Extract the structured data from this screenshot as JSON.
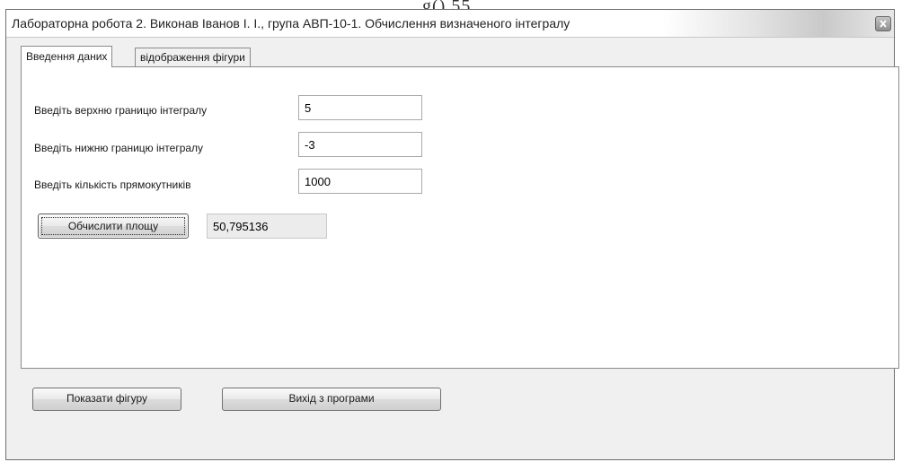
{
  "window": {
    "title": "Лабораторна робота 2. Виконав Іванов І. І., група АВП-10-1. Обчислення визначеного інтегралу"
  },
  "tabs": [
    {
      "label": "Введення даних",
      "active": true
    },
    {
      "label": "відображення фігури",
      "active": false
    }
  ],
  "form": {
    "upper_label": "Введіть верхню границю інтегралу",
    "upper_value": "5",
    "lower_label": "Введіть нижню границю інтегралу",
    "lower_value": "-3",
    "count_label": "Введіть кількість прямокутників",
    "count_value": "1000",
    "calc_button": "Обчислити площу",
    "result_value": "50,795136"
  },
  "bottom": {
    "show_button": "Показати фігуру",
    "exit_button": "Вихід з програми"
  },
  "icons": {
    "close": "close-icon"
  },
  "colors": {
    "window_bg": "#f0f0f0",
    "panel_bg": "#ffffff",
    "border": "#8a8a8a"
  }
}
